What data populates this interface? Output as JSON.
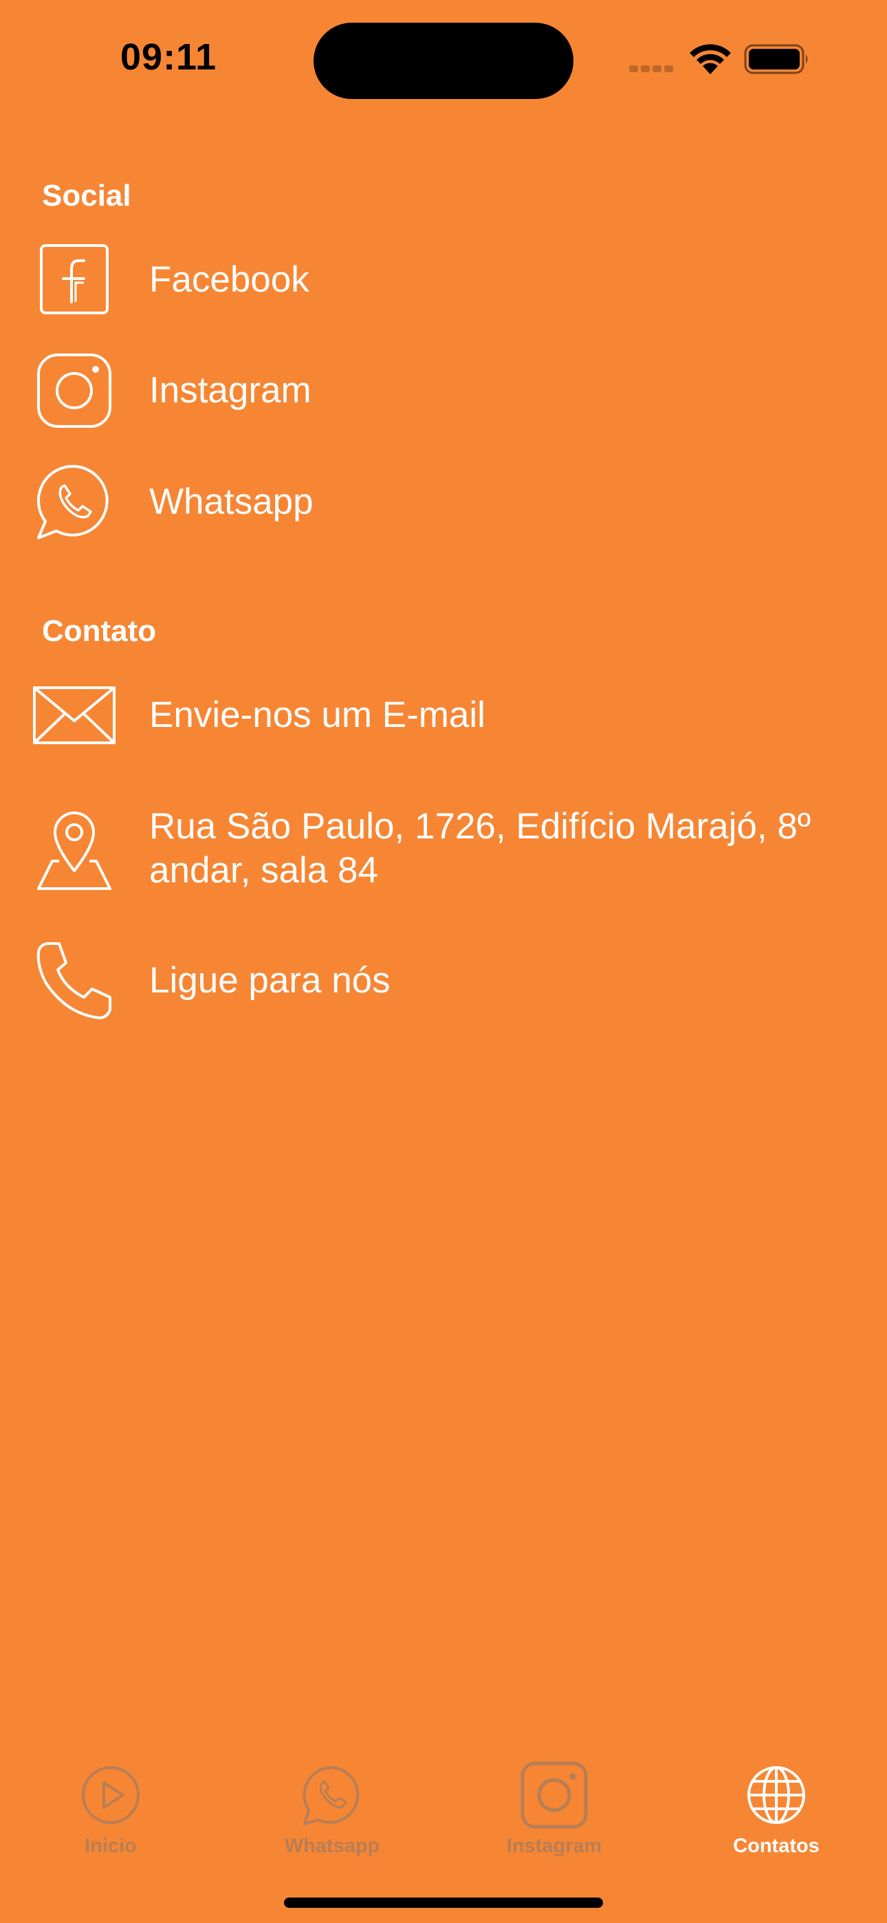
{
  "status_bar": {
    "time": "09:11"
  },
  "social": {
    "title": "Social",
    "items": [
      {
        "label": "Facebook",
        "icon": "facebook-icon"
      },
      {
        "label": "Instagram",
        "icon": "instagram-icon"
      },
      {
        "label": "Whatsapp",
        "icon": "whatsapp-icon"
      }
    ]
  },
  "contato": {
    "title": "Contato",
    "items": [
      {
        "label": "Envie-nos um E-mail",
        "icon": "envelope-icon"
      },
      {
        "label": "Rua São Paulo, 1726, Edifício Marajó, 8º andar, sala 84",
        "icon": "map-pin-icon"
      },
      {
        "label": "Ligue para nós",
        "icon": "phone-icon"
      }
    ]
  },
  "tab_bar": {
    "tabs": [
      {
        "label": "Inicio",
        "icon": "play-icon",
        "active": false
      },
      {
        "label": "Whatsapp",
        "icon": "whatsapp-icon",
        "active": false
      },
      {
        "label": "Instagram",
        "icon": "instagram-icon",
        "active": false
      },
      {
        "label": "Contatos",
        "icon": "globe-icon",
        "active": true
      }
    ]
  },
  "colors": {
    "background": "#F68634",
    "text": "#FFFFFF",
    "tab_inactive": "#B87E55",
    "tab_active": "#FFFFFF"
  }
}
